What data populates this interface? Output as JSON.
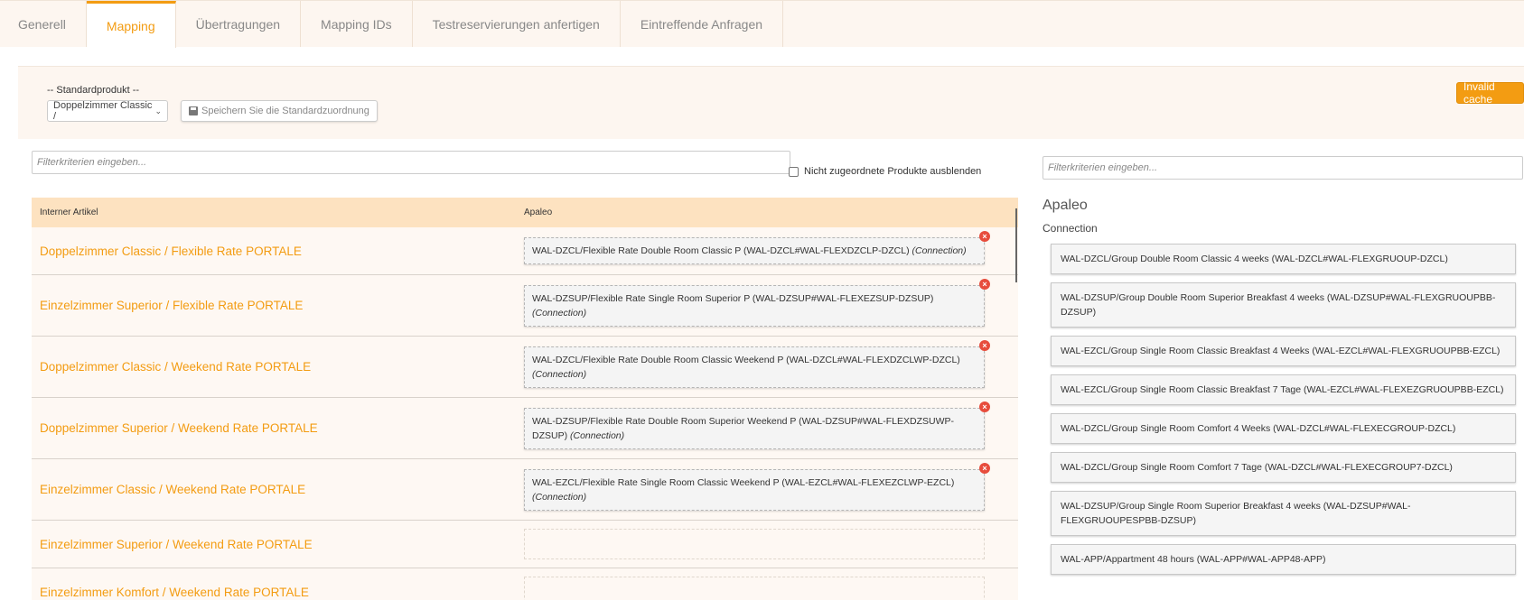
{
  "tabs": [
    {
      "label": "Generell",
      "active": false
    },
    {
      "label": "Mapping",
      "active": true
    },
    {
      "label": "Übertragungen",
      "active": false
    },
    {
      "label": "Mapping IDs",
      "active": false
    },
    {
      "label": "Testreservierungen anfertigen",
      "active": false
    },
    {
      "label": "Eintreffende Anfragen",
      "active": false
    }
  ],
  "standard": {
    "label": "-- Standardprodukt --",
    "selected": "Doppelzimmer Classic /",
    "save_label": "Speichern Sie die Standardzuordnung",
    "cache_label": "Invalid cache"
  },
  "left_filter": {
    "placeholder": "Filterkriterien eingeben..."
  },
  "hide_unassigned": {
    "label": "Nicht zugeordnete Produkte ausblenden"
  },
  "right_filter": {
    "placeholder": "Filterkriterien eingeben..."
  },
  "table": {
    "headers": {
      "internal": "Interner Artikel",
      "apaleo": "Apaleo"
    },
    "rows": [
      {
        "name": "Doppelzimmer Classic / Flexible Rate PORTALE",
        "mapping": "WAL-DZCL/Flexible Rate Double Room Classic P (WAL-DZCL#WAL-FLEXDZCLP-DZCL)",
        "tag": "(Connection)"
      },
      {
        "name": "Einzelzimmer Superior / Flexible Rate PORTALE",
        "mapping": "WAL-DZSUP/Flexible Rate Single Room Superior P (WAL-DZSUP#WAL-FLEXEZSUP-DZSUP)",
        "tag": "(Connection)"
      },
      {
        "name": "Doppelzimmer Classic / Weekend Rate PORTALE",
        "mapping": "WAL-DZCL/Flexible Rate Double Room Classic Weekend P (WAL-DZCL#WAL-FLEXDZCLWP-DZCL)",
        "tag": "(Connection)"
      },
      {
        "name": "Doppelzimmer Superior / Weekend Rate PORTALE",
        "mapping": "WAL-DZSUP/Flexible Rate Double Room Superior Weekend P (WAL-DZSUP#WAL-FLEXDZSUWP-DZSUP)",
        "tag": "(Connection)"
      },
      {
        "name": "Einzelzimmer Classic / Weekend Rate PORTALE",
        "mapping": "WAL-EZCL/Flexible Rate Single Room Classic Weekend P (WAL-EZCL#WAL-FLEXEZCLWP-EZCL)",
        "tag": "(Connection)"
      },
      {
        "name": "Einzelzimmer Superior / Weekend Rate PORTALE",
        "mapping": "",
        "tag": ""
      },
      {
        "name": "Einzelzimmer Komfort / Weekend Rate PORTALE",
        "mapping": "",
        "tag": ""
      }
    ]
  },
  "right_panel": {
    "title": "Apaleo",
    "subtitle": "Connection",
    "items": [
      "WAL-DZCL/Group Double Room Classic 4 weeks (WAL-DZCL#WAL-FLEXGRUOUP-DZCL)",
      "WAL-DZSUP/Group Double Room Superior Breakfast 4 weeks (WAL-DZSUP#WAL-FLEXGRUOUPBB-DZSUP)",
      "WAL-EZCL/Group Single Room Classic Breakfast 4 Weeks (WAL-EZCL#WAL-FLEXGRUOUPBB-EZCL)",
      "WAL-EZCL/Group Single Room Classic Breakfast 7 Tage (WAL-EZCL#WAL-FLEXEZGRUOUPBB-EZCL)",
      "WAL-DZCL/Group Single Room Comfort 4 Weeks (WAL-DZCL#WAL-FLEXECGROUP-DZCL)",
      "WAL-DZCL/Group Single Room Comfort 7 Tage (WAL-DZCL#WAL-FLEXECGROUP7-DZCL)",
      "WAL-DZSUP/Group Single Room Superior Breakfast 4 weeks (WAL-DZSUP#WAL-FLEXGRUOUPESPBB-DZSUP)",
      "WAL-APP/Appartment 48 hours (WAL-APP#WAL-APP48-APP)"
    ]
  },
  "colors": {
    "accent": "#f39c12",
    "header_bg": "#fde2c0",
    "panel_bg": "#fdf6f0",
    "remove": "#e74c3c"
  }
}
